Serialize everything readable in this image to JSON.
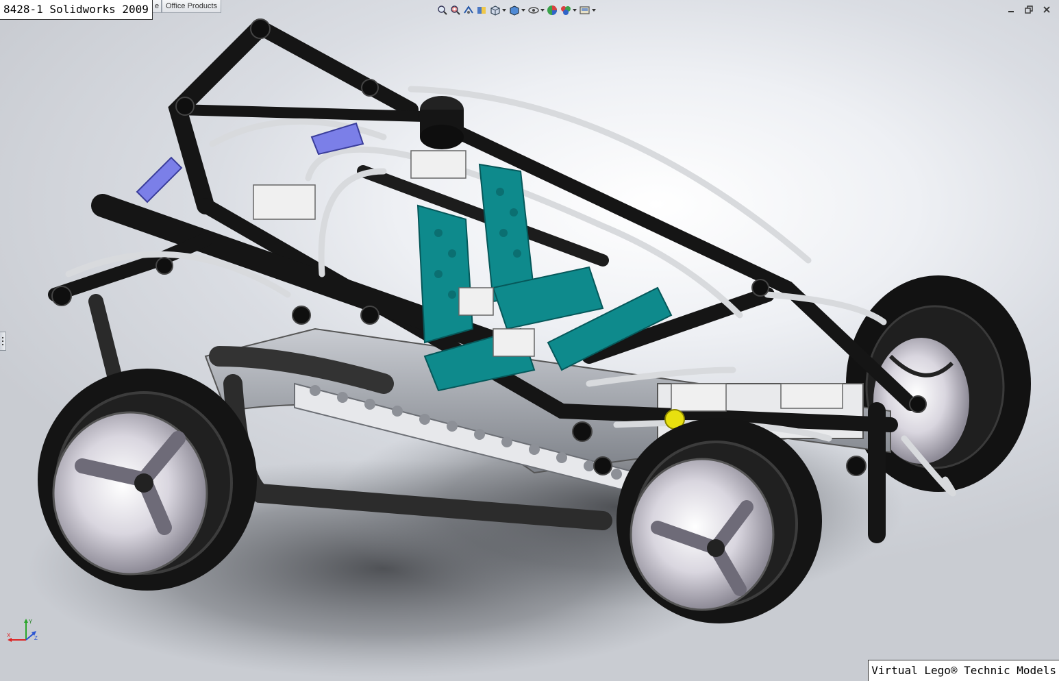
{
  "window": {
    "title_overlay": "8428-1 Solidworks 2009",
    "caption_overlay": "Virtual Lego® Technic Models"
  },
  "tabs": [
    {
      "label": "e",
      "partial": true
    },
    {
      "label": "Office Products"
    }
  ],
  "heads_up_toolbar": [
    {
      "icon": "zoom-to-fit-icon"
    },
    {
      "icon": "zoom-to-area-icon"
    },
    {
      "icon": "previous-view-icon"
    },
    {
      "icon": "section-view-icon"
    },
    {
      "icon": "view-orientation-icon",
      "dropdown": true
    },
    {
      "icon": "display-style-icon",
      "dropdown": true
    },
    {
      "icon": "hide-show-items-icon",
      "dropdown": true
    },
    {
      "icon": "edit-appearance-icon"
    },
    {
      "icon": "apply-scene-icon",
      "dropdown": true
    },
    {
      "icon": "view-settings-icon",
      "dropdown": true
    }
  ],
  "window_controls": [
    "minimize-icon",
    "restore-icon",
    "close-icon"
  ],
  "triad": {
    "axes": [
      "X",
      "Y",
      "Z"
    ]
  },
  "model": {
    "colors": {
      "black_parts": "#151515",
      "gray_beams": "#9a9ea6",
      "white_parts": "#f0f0f0",
      "teal_seats": "#0e8a8c",
      "purple_pins": "#7b7fe8",
      "yellow_gears": "#e8e00f",
      "flex_tubes": "#d8dadd",
      "rim": "#e6e4ea"
    }
  }
}
